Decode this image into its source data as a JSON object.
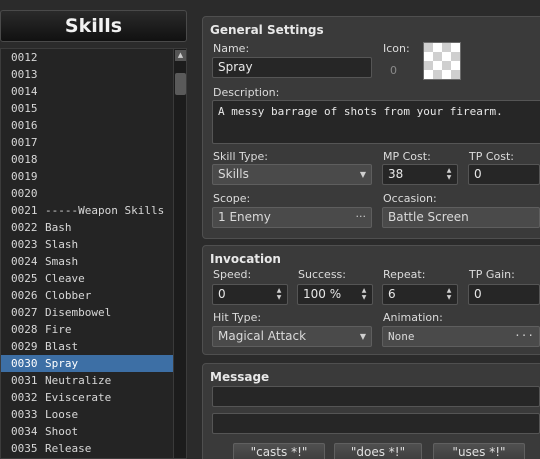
{
  "left_panel": {
    "title": "Skills",
    "items": [
      {
        "id": "0012",
        "name": ""
      },
      {
        "id": "0013",
        "name": ""
      },
      {
        "id": "0014",
        "name": ""
      },
      {
        "id": "0015",
        "name": ""
      },
      {
        "id": "0016",
        "name": ""
      },
      {
        "id": "0017",
        "name": ""
      },
      {
        "id": "0018",
        "name": ""
      },
      {
        "id": "0019",
        "name": ""
      },
      {
        "id": "0020",
        "name": ""
      },
      {
        "id": "0021",
        "name": "-----Weapon Skills"
      },
      {
        "id": "0022",
        "name": "Bash"
      },
      {
        "id": "0023",
        "name": "Slash"
      },
      {
        "id": "0024",
        "name": "Smash"
      },
      {
        "id": "0025",
        "name": "Cleave"
      },
      {
        "id": "0026",
        "name": "Clobber"
      },
      {
        "id": "0027",
        "name": "Disembowel"
      },
      {
        "id": "0028",
        "name": "Fire"
      },
      {
        "id": "0029",
        "name": "Blast"
      },
      {
        "id": "0030",
        "name": "Spray",
        "selected": true
      },
      {
        "id": "0031",
        "name": "Neutralize"
      },
      {
        "id": "0032",
        "name": "Eviscerate"
      },
      {
        "id": "0033",
        "name": "Loose"
      },
      {
        "id": "0034",
        "name": "Shoot"
      },
      {
        "id": "0035",
        "name": "Release"
      }
    ]
  },
  "general": {
    "title": "General Settings",
    "name_label": "Name:",
    "name_value": "Spray",
    "icon_label": "Icon:",
    "icon_index": "0",
    "description_label": "Description:",
    "description_value": "A messy barrage of shots from your firearm.",
    "skill_type_label": "Skill Type:",
    "skill_type_value": "Skills",
    "mp_cost_label": "MP Cost:",
    "mp_cost_value": "38",
    "tp_cost_label": "TP Cost:",
    "tp_cost_value": "0",
    "scope_label": "Scope:",
    "scope_value": "1 Enemy",
    "occasion_label": "Occasion:",
    "occasion_value": "Battle Screen"
  },
  "invocation": {
    "title": "Invocation",
    "speed_label": "Speed:",
    "speed_value": "0",
    "success_label": "Success:",
    "success_value": "100 %",
    "repeat_label": "Repeat:",
    "repeat_value": "6",
    "tp_gain_label": "TP Gain:",
    "tp_gain_value": "0",
    "hit_type_label": "Hit Type:",
    "hit_type_value": "Magical Attack",
    "animation_label": "Animation:",
    "animation_value": "None"
  },
  "message": {
    "title": "Message",
    "line1": "",
    "line2": "",
    "buttons": [
      "\"casts *!\"",
      "\"does *!\"",
      "\"uses *!\""
    ]
  },
  "glyphs": {
    "combo_arrow": "▼",
    "ellipsis": "···",
    "spin_up": "▲",
    "spin_down": "▼",
    "scroll_up": "▲"
  },
  "colors": {
    "selection": "#3d6fa5",
    "panel": "#3a3a3a",
    "field": "#262626"
  }
}
